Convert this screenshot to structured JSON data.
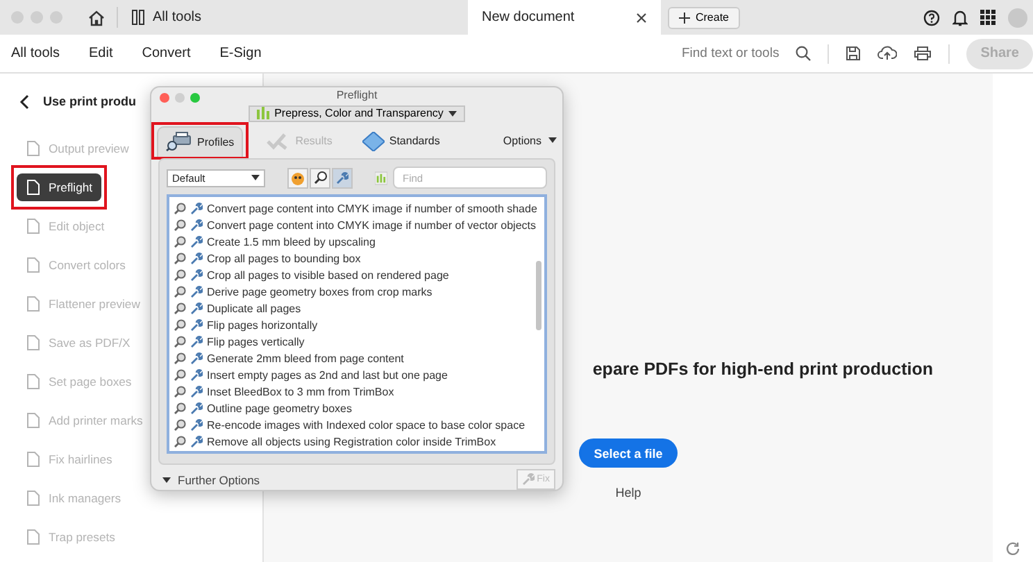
{
  "titlebar": {
    "tabs": [
      {
        "label": "All tools",
        "selected": false
      },
      {
        "label": "New document",
        "selected": true
      }
    ],
    "create_button": "Create"
  },
  "toolbar": {
    "menu": [
      "All tools",
      "Edit",
      "Convert",
      "E-Sign"
    ],
    "search_placeholder": "Find text or tools",
    "share_button": {
      "label": "Share",
      "disabled": true
    }
  },
  "sidebar": {
    "title": "Use print produ",
    "items": [
      {
        "label": "Output preview",
        "selected": false,
        "highlighted": false
      },
      {
        "label": "Preflight",
        "selected": true,
        "highlighted": true
      },
      {
        "label": "Edit object",
        "selected": false,
        "highlighted": false
      },
      {
        "label": "Convert colors",
        "selected": false,
        "highlighted": false
      },
      {
        "label": "Flattener preview",
        "selected": false,
        "highlighted": false
      },
      {
        "label": "Save as PDF/X",
        "selected": false,
        "highlighted": false
      },
      {
        "label": "Set page boxes",
        "selected": false,
        "highlighted": false
      },
      {
        "label": "Add printer marks",
        "selected": false,
        "highlighted": false
      },
      {
        "label": "Fix hairlines",
        "selected": false,
        "highlighted": false
      },
      {
        "label": "Ink managers",
        "selected": false,
        "highlighted": false
      },
      {
        "label": "Trap presets",
        "selected": false,
        "highlighted": false
      }
    ]
  },
  "main": {
    "heading": "epare PDFs for high-end print production",
    "button": "Select a file",
    "link": "Help"
  },
  "dialog": {
    "title": "Preflight",
    "library": "Prepress, Color and Transparency",
    "tabs": [
      {
        "label": "Profiles",
        "selected": true,
        "disabled": false,
        "highlighted": true
      },
      {
        "label": "Results",
        "selected": false,
        "disabled": true,
        "highlighted": false
      },
      {
        "label": "Standards",
        "selected": false,
        "disabled": false,
        "highlighted": false
      }
    ],
    "options": "Options",
    "profile_select": "Default",
    "find_placeholder": "Find",
    "profiles": [
      "Convert page content into CMYK image if number of smooth shade",
      "Convert page content into CMYK image if number of vector objects",
      "Create 1.5 mm bleed by upscaling",
      "Crop all pages to bounding box",
      "Crop all pages to visible based on rendered page",
      "Derive page geometry boxes from crop marks",
      "Duplicate all pages",
      "Flip pages horizontally",
      "Flip pages vertically",
      "Generate 2mm bleed from page content",
      "Insert empty pages as 2nd and last but one page",
      "Inset BleedBox to 3 mm from TrimBox",
      "Outline page geometry boxes",
      "Re-encode images with Indexed color space to base color space",
      "Remove all objects using Registration color inside TrimBox"
    ],
    "further_options": "Further Options",
    "fix_button": {
      "label": "Fix",
      "disabled": true
    }
  }
}
